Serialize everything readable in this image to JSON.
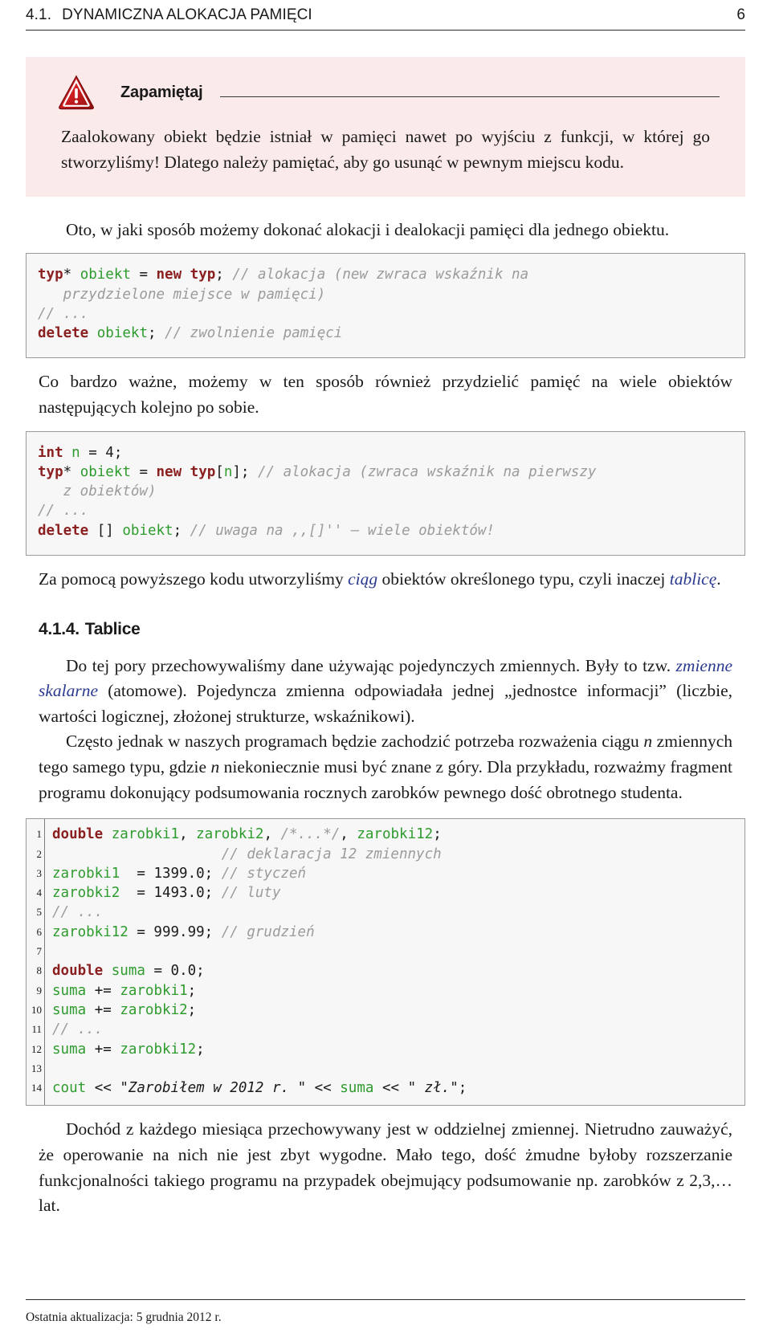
{
  "runhead": {
    "section_number": "4.1.",
    "section_title": "DYNAMICZNA ALOKACJA PAMIĘCI",
    "page_number": "6"
  },
  "callout": {
    "icon": "warning-triangle-icon",
    "title": "Zapamiętaj",
    "body": "Zaalokowany obiekt będzie istniał w pamięci nawet po wyjściu z funkcji, w której go stworzyliśmy! Dlatego należy pamiętać, aby go usunąć w pewnym miejscu kodu.",
    "background_color": "#fbeaea"
  },
  "paragraphs": {
    "intro_alloc": "Oto, w jaki sposób możemy dokonać alokacji i dealokacji pamięci dla jednego obiektu.",
    "many_objects": "Co bardzo ważne, możemy w ten sposób również przydzielić pamięć na wiele obiektów następujących kolejno po sobie.",
    "array_lead_1": "Za pomocą powyższego kodu utworzyliśmy ",
    "array_lead_em1": "ciąg",
    "array_lead_2": " obiektów określonego typu, czyli inaczej ",
    "array_lead_em2": "tablicę",
    "array_lead_3": ".",
    "scalars_1": "Do tej pory przechowywaliśmy dane używając pojedynczych zmiennych. Były to tzw. ",
    "scalars_em": "zmienne skalarne",
    "scalars_2": " (atomowe). Pojedyncza zmienna odpowiadała jednej „jednostce informacji” (liczbie, wartości logicznej, złożonej strukturze, wskaźnikowi).",
    "sequence_1": "Często jednak w naszych programach będzie zachodzić potrzeba rozważenia ciągu ",
    "sequence_n1": "n",
    "sequence_2": " zmiennych tego samego typu, gdzie ",
    "sequence_n2": "n",
    "sequence_3": " niekoniecznie musi być znane z góry. Dla przykładu, rozważmy fragment programu dokonujący podsumowania rocznych zarobków pewnego dość obrotnego studenta.",
    "closing": "Dochód z każdego miesiąca przechowywany jest w oddzielnej zmiennej. Nietrudno zauważyć, że operowanie na nich nie jest zbyt wygodne. Mało tego, dość żmudne byłoby rozszerzanie funkcjonalności takiego programu na przypadek obejmujący podsumowanie np. zarobków z 2,3,… lat."
  },
  "section": {
    "number": "4.1.4.",
    "title": "Tablice"
  },
  "code_single": {
    "lines": [
      [
        {
          "t": "typ",
          "c": "kw"
        },
        {
          "t": "* ",
          "c": "pl"
        },
        {
          "t": "obiekt",
          "c": "id"
        },
        {
          "t": " = ",
          "c": "pl"
        },
        {
          "t": "new",
          "c": "kw"
        },
        {
          "t": " ",
          "c": "pl"
        },
        {
          "t": "typ",
          "c": "kw"
        },
        {
          "t": "; ",
          "c": "pl"
        },
        {
          "t": "// alokacja (new zwraca wskaźnik na",
          "c": "cm"
        }
      ],
      [
        {
          "t": "   przydzielone miejsce w pamięci)",
          "c": "cm"
        }
      ],
      [
        {
          "t": "// ...",
          "c": "cm"
        }
      ],
      [
        {
          "t": "delete",
          "c": "kw"
        },
        {
          "t": " ",
          "c": "pl"
        },
        {
          "t": "obiekt",
          "c": "id"
        },
        {
          "t": "; ",
          "c": "pl"
        },
        {
          "t": "// zwolnienie pamięci",
          "c": "cm"
        }
      ]
    ]
  },
  "code_array": {
    "lines": [
      [
        {
          "t": "int",
          "c": "kw"
        },
        {
          "t": " ",
          "c": "pl"
        },
        {
          "t": "n",
          "c": "id"
        },
        {
          "t": " = 4;",
          "c": "pl"
        }
      ],
      [
        {
          "t": "typ",
          "c": "kw"
        },
        {
          "t": "* ",
          "c": "pl"
        },
        {
          "t": "obiekt",
          "c": "id"
        },
        {
          "t": " = ",
          "c": "pl"
        },
        {
          "t": "new",
          "c": "kw"
        },
        {
          "t": " ",
          "c": "pl"
        },
        {
          "t": "typ",
          "c": "kw"
        },
        {
          "t": "[",
          "c": "pl"
        },
        {
          "t": "n",
          "c": "id"
        },
        {
          "t": "]; ",
          "c": "pl"
        },
        {
          "t": "// alokacja (zwraca wskaźnik na pierwszy",
          "c": "cm"
        }
      ],
      [
        {
          "t": "   z obiektów)",
          "c": "cm"
        }
      ],
      [
        {
          "t": "// ...",
          "c": "cm"
        }
      ],
      [
        {
          "t": "delete",
          "c": "kw"
        },
        {
          "t": " [] ",
          "c": "pl"
        },
        {
          "t": "obiekt",
          "c": "id"
        },
        {
          "t": "; ",
          "c": "pl"
        },
        {
          "t": "// uwaga na ,,[]'' – wiele obiektów!",
          "c": "cm"
        }
      ]
    ]
  },
  "code_numbered": {
    "line_numbers": [
      "1",
      "2",
      "3",
      "4",
      "5",
      "6",
      "7",
      "8",
      "9",
      "10",
      "11",
      "12",
      "13",
      "14"
    ],
    "lines": [
      [
        {
          "t": "double",
          "c": "kw"
        },
        {
          "t": " ",
          "c": "pl"
        },
        {
          "t": "zarobki1",
          "c": "id"
        },
        {
          "t": ", ",
          "c": "pl"
        },
        {
          "t": "zarobki2",
          "c": "id"
        },
        {
          "t": ", ",
          "c": "pl"
        },
        {
          "t": "/*...*/",
          "c": "cm"
        },
        {
          "t": ", ",
          "c": "pl"
        },
        {
          "t": "zarobki12",
          "c": "id"
        },
        {
          "t": ";",
          "c": "pl"
        }
      ],
      [
        {
          "t": "                    // deklaracja 12 zmiennych",
          "c": "cm"
        }
      ],
      [
        {
          "t": "zarobki1",
          "c": "id"
        },
        {
          "t": "  = 1399.0; ",
          "c": "pl"
        },
        {
          "t": "// styczeń",
          "c": "cm"
        }
      ],
      [
        {
          "t": "zarobki2",
          "c": "id"
        },
        {
          "t": "  = 1493.0; ",
          "c": "pl"
        },
        {
          "t": "// luty",
          "c": "cm"
        }
      ],
      [
        {
          "t": "// ...",
          "c": "cm"
        }
      ],
      [
        {
          "t": "zarobki12",
          "c": "id"
        },
        {
          "t": " = 999.99; ",
          "c": "pl"
        },
        {
          "t": "// grudzień",
          "c": "cm"
        }
      ],
      [
        {
          "t": "",
          "c": "pl"
        }
      ],
      [
        {
          "t": "double",
          "c": "kw"
        },
        {
          "t": " ",
          "c": "pl"
        },
        {
          "t": "suma",
          "c": "id"
        },
        {
          "t": " = 0.0;",
          "c": "pl"
        }
      ],
      [
        {
          "t": "suma",
          "c": "id"
        },
        {
          "t": " += ",
          "c": "pl"
        },
        {
          "t": "zarobki1",
          "c": "id"
        },
        {
          "t": ";",
          "c": "pl"
        }
      ],
      [
        {
          "t": "suma",
          "c": "id"
        },
        {
          "t": " += ",
          "c": "pl"
        },
        {
          "t": "zarobki2",
          "c": "id"
        },
        {
          "t": ";",
          "c": "pl"
        }
      ],
      [
        {
          "t": "// ...",
          "c": "cm"
        }
      ],
      [
        {
          "t": "suma",
          "c": "id"
        },
        {
          "t": " += ",
          "c": "pl"
        },
        {
          "t": "zarobki12",
          "c": "id"
        },
        {
          "t": ";",
          "c": "pl"
        }
      ],
      [
        {
          "t": "",
          "c": "pl"
        }
      ],
      [
        {
          "t": "cout",
          "c": "id"
        },
        {
          "t": " << ",
          "c": "pl"
        },
        {
          "t": "\"Zarobiłem w 2012 r. \"",
          "c": "st"
        },
        {
          "t": " << ",
          "c": "pl"
        },
        {
          "t": "suma",
          "c": "id"
        },
        {
          "t": " << ",
          "c": "pl"
        },
        {
          "t": "\" zł.\"",
          "c": "st"
        },
        {
          "t": ";",
          "c": "pl"
        }
      ]
    ]
  },
  "footer": {
    "text": "Ostatnia aktualizacja: 5 grudnia 2012 r."
  },
  "colors": {
    "keyword": "#8b2020",
    "identifier": "#2e9b2e",
    "comment": "#9b9b9b",
    "emphasis_link": "#2b3a8f",
    "callout_bg": "#fbeaea"
  }
}
